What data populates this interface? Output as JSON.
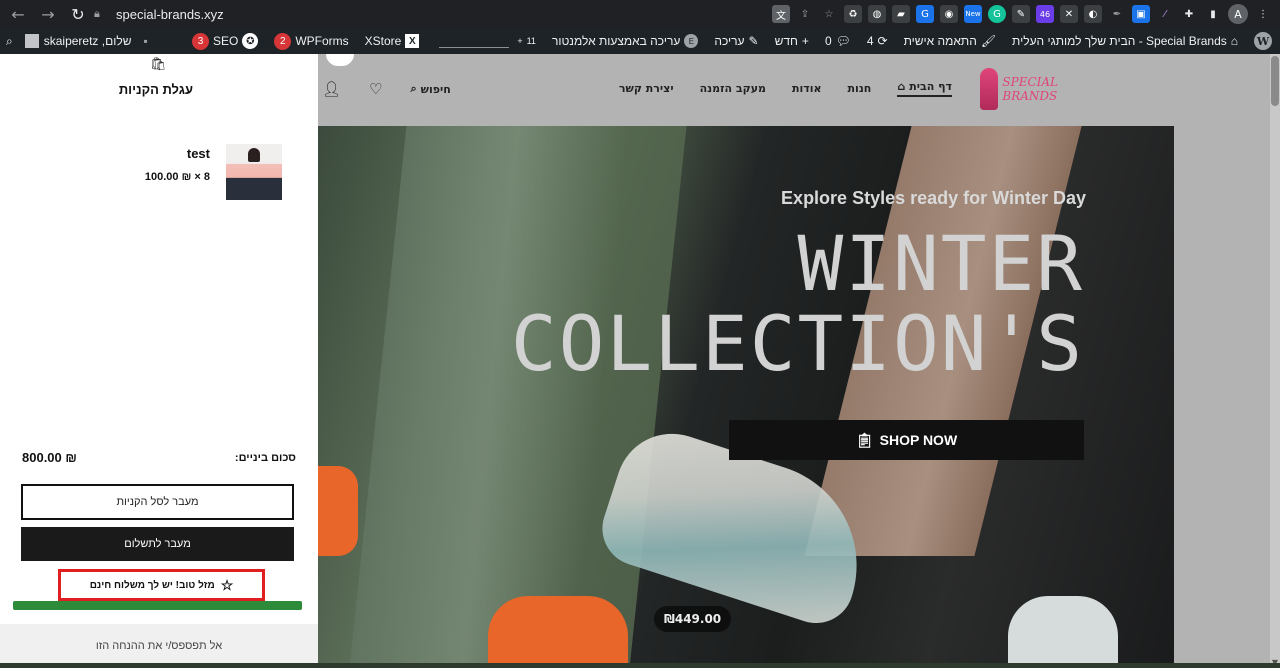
{
  "browser": {
    "url": "special-brands.xyz",
    "back_icon": "arrow-left",
    "forward_icon": "arrow-right",
    "reload_icon": "reload",
    "ext_badge_new": "New",
    "ext_badge_46": "46",
    "profile_initial": "A"
  },
  "wp_admin_bar": {
    "site_name": "Special Brands - הבית שלך למותגי העלית",
    "customize": "התאמה אישית",
    "updates_count": "4",
    "comments_count": "0",
    "new": "חדש",
    "edit": "עריכה",
    "elementor_edit": "עריכה באמצעות אלמנטור",
    "traffic_count": "11",
    "xstore": "XStore",
    "wpforms": "WPForms",
    "wpforms_count": "2",
    "seo": "SEO",
    "seo_count": "3",
    "greeting": "שלום, skaiperetz"
  },
  "site_header": {
    "logo_text": "SPECIAL BRANDS",
    "menu": [
      {
        "label": "דף הבית",
        "active": true
      },
      {
        "label": "חנות"
      },
      {
        "label": "אודות"
      },
      {
        "label": "מעקב הזמנה"
      },
      {
        "label": "יצירת קשר"
      }
    ],
    "search_label": "חיפוש"
  },
  "hero": {
    "subtitle": "Explore Styles ready for Winter Day",
    "title_line1": "WINTER",
    "title_line2": "COLLECTION'S",
    "button": "SHOP NOW",
    "price_tag": "₪449.00"
  },
  "cart": {
    "title": "עגלת הקניות",
    "item": {
      "name": "test",
      "quantity": "8",
      "price": "100.00",
      "currency": "₪"
    },
    "subtotal_label": "סכום ביניים:",
    "subtotal_value": "800.00",
    "view_cart": "מעבר לסל הקניות",
    "checkout": "מעבר לתשלום",
    "free_shipping": "מזל טוב! יש לך משלוח חינם",
    "progress_percent": 100,
    "dismiss_hint": "אל תפספס/י את ההנחה הזו"
  },
  "colors": {
    "progress_fill": "#2e8b3a",
    "highlight_border": "#e02020",
    "wp_bar": "#1d2327",
    "browser_bar": "#202124"
  }
}
